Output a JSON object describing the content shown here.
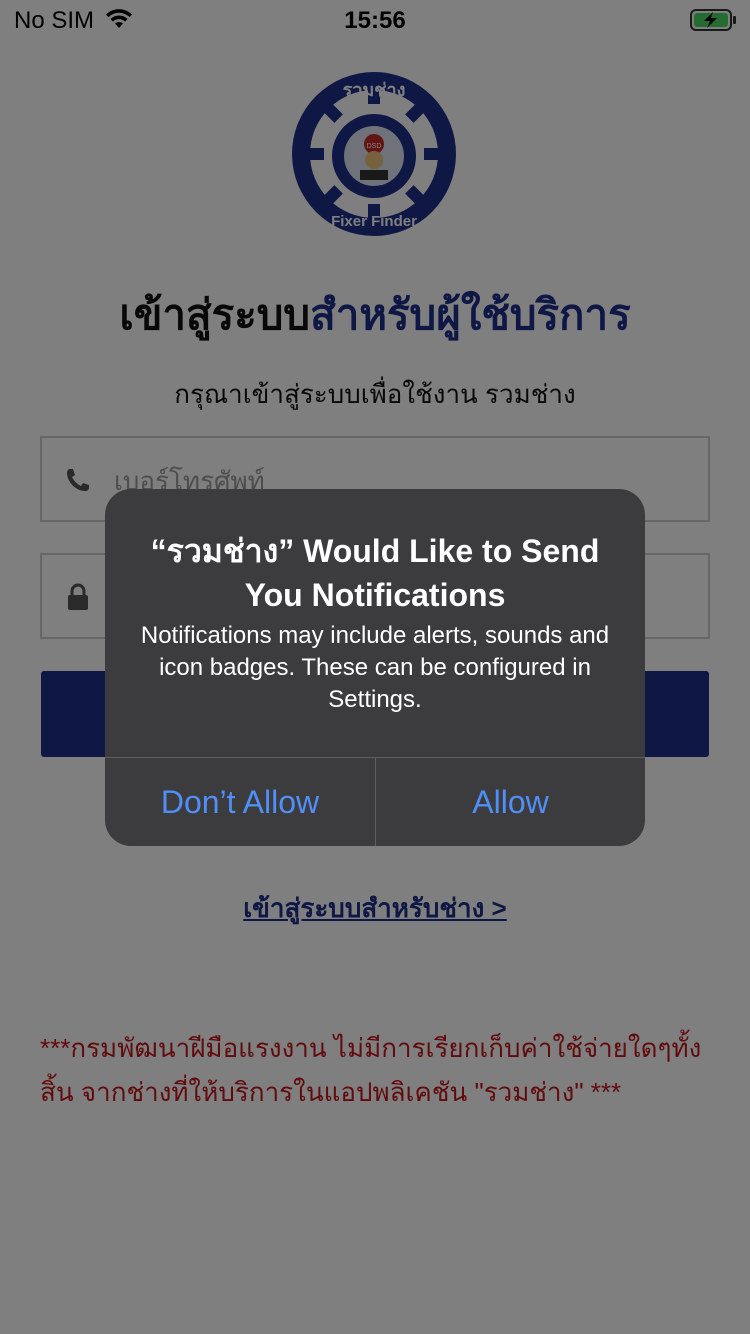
{
  "status_bar": {
    "carrier": "No SIM",
    "time": "15:56",
    "battery_icon": "battery-charging-icon",
    "wifi_icon": "wifi-icon"
  },
  "logo": {
    "text_top": "รวมช่าง",
    "text_bottom": "Fixer Finder",
    "badge": "DSD"
  },
  "heading": {
    "part1": "เข้าสู่ระบบ",
    "part2": "สำหรับผู้ใช้บริการ"
  },
  "subheading": "กรุณาเข้าสู่ระบบเพื่อใช้งาน รวมช่าง",
  "form": {
    "phone_placeholder": "เบอร์โทรศัพท์",
    "phone_icon": "phone-icon",
    "password_placeholder": "",
    "password_icon": "lock-icon"
  },
  "tech_login_link": "เข้าสู่ระบบสำหรับช่าง >",
  "disclaimer": "***กรมพัฒนาฝีมือแรงงาน ไม่มีการเรียกเก็บค่าใช้จ่ายใดๆทั้งสิ้น จากช่างที่ให้บริการในแอปพลิเคชัน \"รวมช่าง\" ***",
  "alert": {
    "title": "“รวมช่าง” Would Like to Send You Notifications",
    "message": "Notifications may include alerts, sounds and icon badges. These can be configured in Settings.",
    "dont_allow": "Don’t Allow",
    "allow": "Allow"
  },
  "colors": {
    "brand_navy": "#1f2e8a",
    "alert_button_blue": "#4f8ff7",
    "disclaimer_red": "#c4161c"
  }
}
